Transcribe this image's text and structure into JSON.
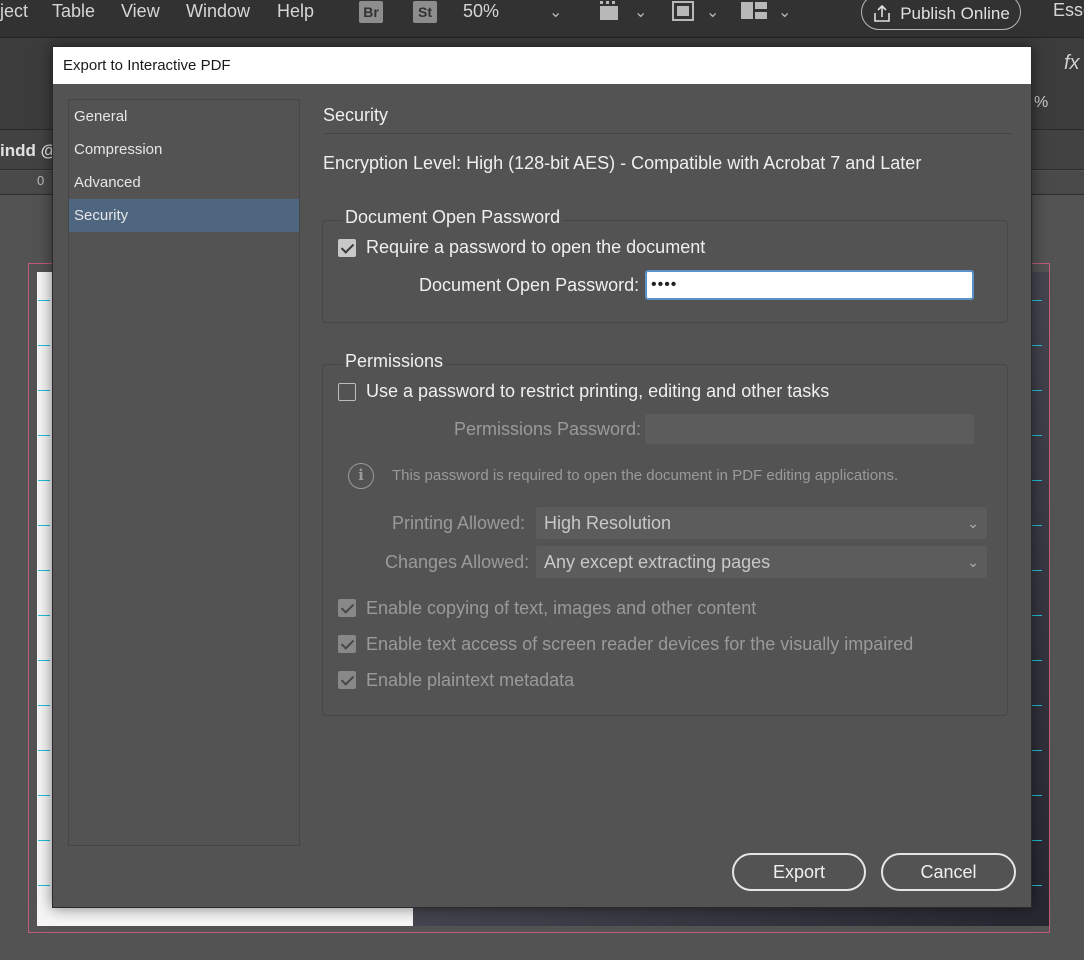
{
  "menubar": {
    "items": [
      "ject",
      "Table",
      "View",
      "Window",
      "Help"
    ],
    "bridge_badge": "Br",
    "stock_badge": "St",
    "zoom": "50%",
    "publish_label": "Publish Online",
    "workspace": "Esse"
  },
  "ctrlbar": {
    "fx": "fx",
    "percent": "%"
  },
  "doc": {
    "tab_label": "indd @",
    "ruler_zero": "0"
  },
  "dialog": {
    "title": "Export to Interactive PDF",
    "sidebar": [
      "General",
      "Compression",
      "Advanced",
      "Security"
    ],
    "active_index": 3,
    "section_title": "Security",
    "encryption_level": "Encryption Level: High (128-bit AES) - Compatible with Acrobat 7 and Later",
    "open_group": {
      "title": "Document Open Password",
      "require_label": "Require a password to open the document",
      "require_checked": true,
      "password_label": "Document Open Password:",
      "password_value": "••••"
    },
    "permissions": {
      "title": "Permissions",
      "restrict_label": "Use a password to restrict printing, editing and other tasks",
      "restrict_checked": false,
      "password_label": "Permissions Password:",
      "password_value": "",
      "info_text": "This password is required to open the document in PDF editing applications.",
      "printing_label": "Printing Allowed:",
      "printing_value": "High Resolution",
      "changes_label": "Changes Allowed:",
      "changes_value": "Any except extracting pages",
      "options": [
        {
          "label": "Enable copying of text, images and other content",
          "checked": true
        },
        {
          "label": "Enable text access of screen reader devices for the visually impaired",
          "checked": true
        },
        {
          "label": "Enable plaintext metadata",
          "checked": true
        }
      ]
    },
    "export_label": "Export",
    "cancel_label": "Cancel"
  },
  "colors": {
    "accent_selection": "#4e6680",
    "focus_border": "#5b90c9",
    "page_border": "#c05c7a",
    "guides": "#21c1dc"
  }
}
